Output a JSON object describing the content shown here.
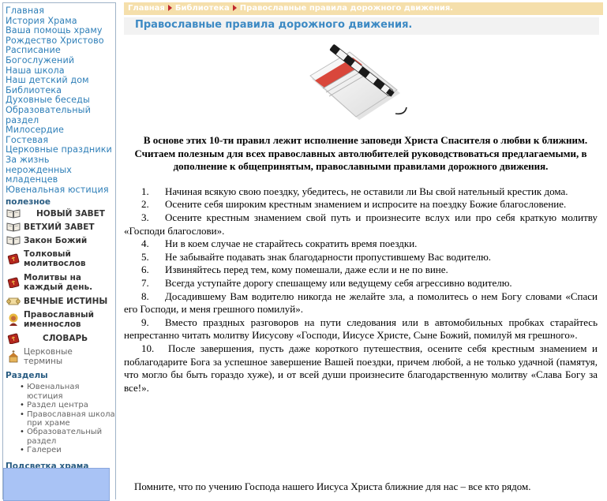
{
  "sidebar": {
    "nav": [
      "Главная",
      "История Храма",
      "Ваша помощь храму",
      "Рождество Христово",
      "Расписание",
      "Богослужений",
      "Наша школа",
      "Наш детский дом",
      "Библиотека",
      "Духовные беседы",
      "Образовательный",
      "раздел",
      "Милосердие",
      "Гостевая",
      "Церковные праздники",
      "За жизнь",
      "нерожденных",
      "младенцев",
      "Ювенальная юстиция"
    ],
    "useful_title": "полезное",
    "useful": [
      {
        "label": "НОВЫЙ ЗАВЕТ",
        "icon": "open-book-icon"
      },
      {
        "label": "ВЕТХИЙ ЗАВЕТ",
        "icon": "open-book-icon"
      },
      {
        "label": "Закон Божий",
        "icon": "open-book-icon"
      },
      {
        "label": "Толковый молитвослов",
        "icon": "prayer-book-icon"
      },
      {
        "label": "Молитвы на каждый день.",
        "icon": "prayer-book-icon"
      },
      {
        "label": "ВЕЧНЫЕ ИСТИНЫ",
        "icon": "scroll-icon"
      },
      {
        "label": "Православный именнослов",
        "icon": "saint-icon"
      },
      {
        "label": "СЛОВАРЬ",
        "icon": "prayer-book-icon"
      },
      {
        "label": "Церковные термины",
        "icon": "church-icon"
      }
    ],
    "sections_title": "Разделы",
    "sections": [
      "Ювенальная юстиция",
      "Раздел центра",
      "Православная школа при храме",
      "Образовательный раздел",
      "Галереи"
    ],
    "support_title": "Подсветка храма"
  },
  "breadcrumb": {
    "home": "Главная",
    "library": "Библиотека",
    "current": "Православные правила дорожного движения."
  },
  "page_title": "Православные правила дорожного движения.",
  "intro": [
    "В основе этих 10-ти правил лежит исполнение заповеди Христа Спасителя о любви к ближним.",
    "Считаем полезным для всех православных автолюбителей руководствоваться предлагаемыми, в дополнение к общепринятым, православными правилами дорожного движения."
  ],
  "rules": [
    {
      "n": "1.",
      "text": "Начиная всякую свою поездку, убедитесь, не оставили ли Вы свой нательный крестик дома."
    },
    {
      "n": "2.",
      "text": "Осените себя широким крестным знамением и испросите на поездку Божие благословение."
    },
    {
      "n": "3.",
      "text": "Осените крестным знамением свой путь и произнесите вслух или про себя краткую молитву «Господи благослови»."
    },
    {
      "n": "4.",
      "text": "Ни в коем случае не старайтесь сократить время поездки."
    },
    {
      "n": "5.",
      "text": "Не забывайте подавать знак благодарности пропустившему Вас водителю."
    },
    {
      "n": "6.",
      "text": "Извиняйтесь перед тем, кому помешали, даже если и не по вине."
    },
    {
      "n": "7.",
      "text": "Всегда уступайте дорогу спешащему или ведущему себя агрессивно водителю."
    },
    {
      "n": "8.",
      "text": "Досадившему Вам водителю никогда не желайте зла, а помолитесь о нем Богу словами «Спаси его Господи, и меня грешного помилуй»."
    },
    {
      "n": "9.",
      "text": "Вместо праздных разговоров на пути следования или в автомобильных пробках старайтесь непрестанно читать молитву Иисусову «Господи, Иисусе Христе, Сыне Божий, помилуй мя грешного»."
    },
    {
      "n": "10.",
      "text": "После завершения, пусть даже короткого путешествия, осените себя крестным знамением и поблагодарите Бога за успешное завершение Вашей поездки, причем любой, а не только удачной (памятуя, что могло бы быть гораздо хуже), и от всей души произнесите благодарственную молитву «Слава Богу за все!»."
    }
  ],
  "closing": "Помните, что по учению Господа нашего Иисуса Христа ближние для нас – все кто рядом."
}
